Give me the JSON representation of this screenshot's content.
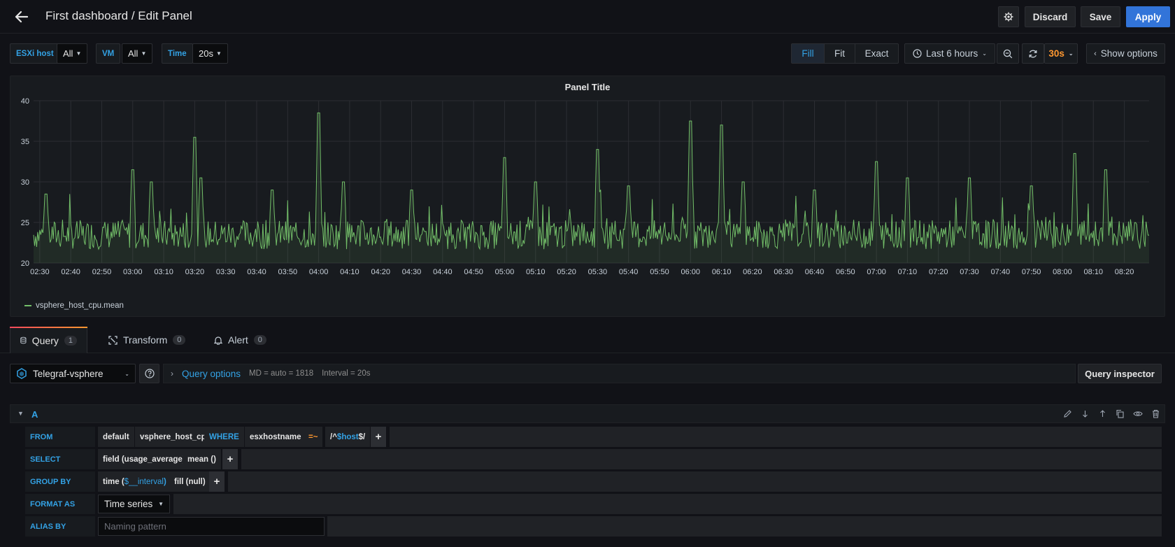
{
  "header": {
    "title": "First dashboard / Edit Panel",
    "discard_label": "Discard",
    "save_label": "Save",
    "apply_label": "Apply"
  },
  "variables": [
    {
      "label": "ESXi host",
      "value": "All"
    },
    {
      "label": "VM",
      "value": "All"
    },
    {
      "label": "Time",
      "value": "20s"
    }
  ],
  "view_modes": [
    "Fill",
    "Fit",
    "Exact"
  ],
  "active_view_mode": "Fill",
  "time_range": "Last 6 hours",
  "refresh_interval": "30s",
  "show_options_label": "Show options",
  "panel": {
    "title": "Panel Title"
  },
  "colors": {
    "series": "#73bf69",
    "accent_blue": "#33a2e5",
    "apply": "#3274d9",
    "refresh": "#ff9830"
  },
  "chart_data": {
    "type": "line",
    "title": "Panel Title",
    "ylim": [
      20,
      40
    ],
    "yticks": [
      20,
      25,
      30,
      35,
      40
    ],
    "xticks": [
      "02:30",
      "02:40",
      "02:50",
      "03:00",
      "03:10",
      "03:20",
      "03:30",
      "03:40",
      "03:50",
      "04:00",
      "04:10",
      "04:20",
      "04:30",
      "04:40",
      "04:50",
      "05:00",
      "05:10",
      "05:20",
      "05:30",
      "05:40",
      "05:50",
      "06:00",
      "06:10",
      "06:20",
      "06:30",
      "06:40",
      "06:50",
      "07:00",
      "07:10",
      "07:20",
      "07:30",
      "07:40",
      "07:50",
      "08:00",
      "08:10",
      "08:20"
    ],
    "x_range": [
      "02:28",
      "08:28"
    ],
    "grid": true,
    "legend_position": "bottom-left",
    "series": [
      {
        "name": "vsphere_host_cpu.mean",
        "baseline": 23.5,
        "noise_amplitude": 1.8,
        "spikes": [
          {
            "time": "02:32",
            "value": 28.5
          },
          {
            "time": "03:00",
            "value": 31.5
          },
          {
            "time": "03:06",
            "value": 30.0
          },
          {
            "time": "03:20",
            "value": 35.5
          },
          {
            "time": "03:22",
            "value": 30.5
          },
          {
            "time": "03:45",
            "value": 29.0
          },
          {
            "time": "04:00",
            "value": 38.5
          },
          {
            "time": "04:08",
            "value": 30.0
          },
          {
            "time": "04:30",
            "value": 29.0
          },
          {
            "time": "05:00",
            "value": 33.0
          },
          {
            "time": "05:10",
            "value": 30.0
          },
          {
            "time": "05:30",
            "value": 34.0
          },
          {
            "time": "05:40",
            "value": 29.5
          },
          {
            "time": "06:00",
            "value": 37.5
          },
          {
            "time": "06:10",
            "value": 37.0
          },
          {
            "time": "06:17",
            "value": 30.0
          },
          {
            "time": "06:40",
            "value": 29.0
          },
          {
            "time": "07:00",
            "value": 32.5
          },
          {
            "time": "07:10",
            "value": 30.5
          },
          {
            "time": "07:30",
            "value": 30.5
          },
          {
            "time": "07:50",
            "value": 29.5
          },
          {
            "time": "08:04",
            "value": 33.5
          },
          {
            "time": "08:14",
            "value": 31.5
          }
        ]
      }
    ]
  },
  "tabs": [
    {
      "label": "Query",
      "count": "1"
    },
    {
      "label": "Transform",
      "count": "0"
    },
    {
      "label": "Alert",
      "count": "0"
    }
  ],
  "query": {
    "datasource": "Telegraf-vsphere",
    "options_label": "Query options",
    "md": "MD = auto = 1818",
    "interval": "Interval = 20s",
    "inspector_label": "Query inspector",
    "ref_id": "A",
    "rows": {
      "from_label": "FROM",
      "from_policy": "default",
      "from_measurement": "vsphere_host_cpu",
      "where_label": "WHERE",
      "where_key": "esxhostname",
      "where_op": "=~",
      "where_value_pre": "/^",
      "where_value_var": "$host",
      "where_value_post": "$/",
      "select_label": "SELECT",
      "select_field": "field (usage_average)",
      "select_fn": "mean ()",
      "group_label": "GROUP BY",
      "group_time_pre": "time (",
      "group_time_var": "$__interval",
      "group_time_post": ")",
      "group_fill": "fill (null)",
      "format_label": "FORMAT AS",
      "format_value": "Time series",
      "alias_label": "ALIAS BY",
      "alias_placeholder": "Naming pattern"
    }
  }
}
